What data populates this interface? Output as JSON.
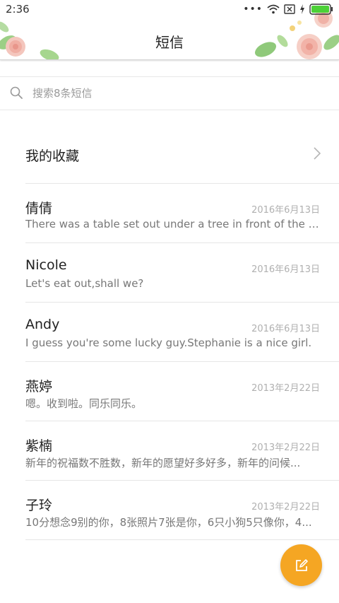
{
  "status_bar": {
    "time": "2:36",
    "dots": "•••"
  },
  "header": {
    "title": "短信"
  },
  "search": {
    "placeholder": "搜索8条短信"
  },
  "favorites": {
    "label": "我的收藏"
  },
  "conversations": [
    {
      "name": "倩倩",
      "date": "2016年6月13日",
      "preview": "There was a table set out under a tree in front of the ho..."
    },
    {
      "name": "Nicole",
      "date": "2016年6月13日",
      "preview": "Let's eat out,shall we?"
    },
    {
      "name": "Andy",
      "date": "2016年6月13日",
      "preview": "I guess you're some lucky guy.Stephanie is a nice girl."
    },
    {
      "name": "燕婷",
      "date": "2013年2月22日",
      "preview": "嗯。收到啦。同乐同乐。"
    },
    {
      "name": "紫楠",
      "date": "2013年2月22日",
      "preview": "新年的祝福数不胜数，新年的愿望好多好多，新年的问候..."
    },
    {
      "name": "子玲",
      "date": "2013年2月22日",
      "preview": "10分想念9别的你，8张照片7张是你，6只小狗5只像你，4..."
    }
  ],
  "colors": {
    "fab": "#f5a623",
    "battery": "#4cd137"
  },
  "icons": {
    "search": "search-icon",
    "chevron": "chevron-right-icon",
    "compose": "compose-icon"
  }
}
